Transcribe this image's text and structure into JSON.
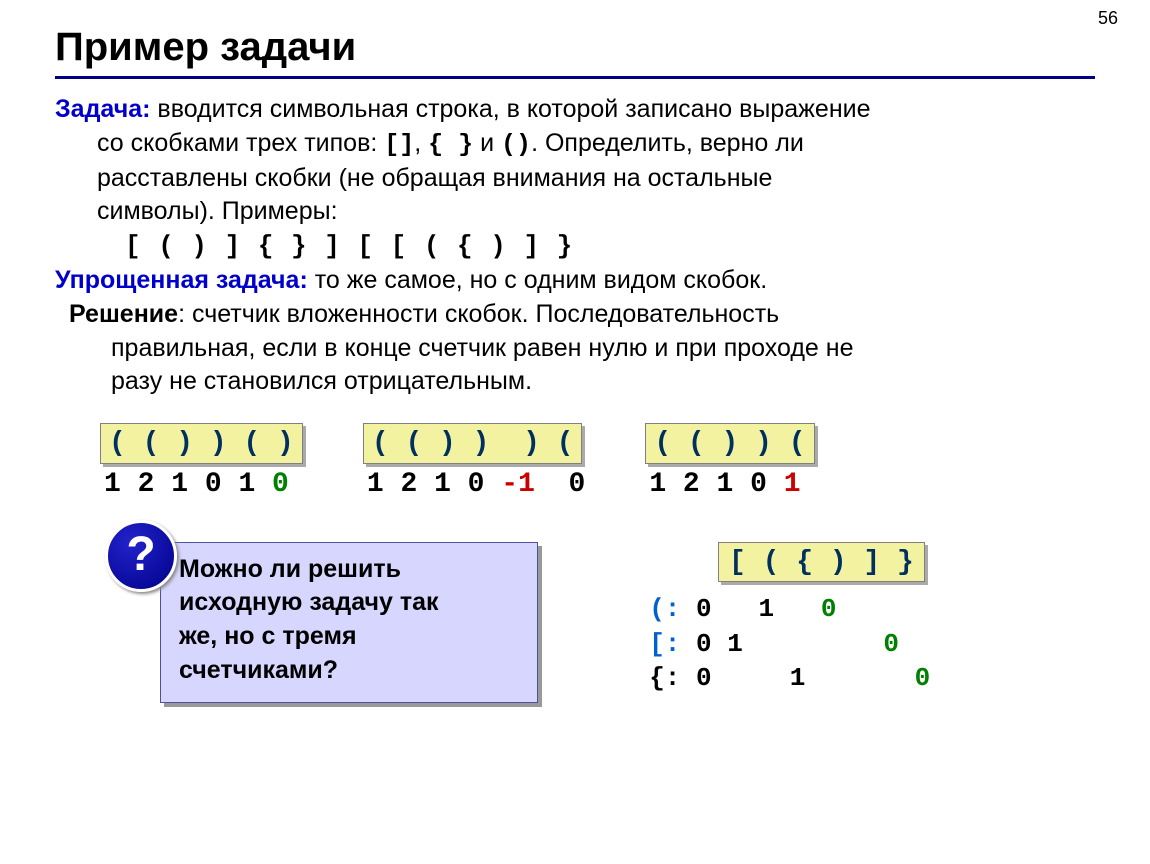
{
  "page_number": "56",
  "title": "Пример задачи",
  "task": {
    "label": "Задача:",
    "text1": " вводится символьная строка, в которой записано выражение",
    "text2": "со скобками трех типов: ",
    "brackets": {
      "b1": "[]",
      "sep1": ", ",
      "b2": "{ }",
      "sep2": " и ",
      "b3": "()"
    },
    "text3": ". Определить, верно ли",
    "text4": "расставлены скобки (не обращая внимания на остальные",
    "text5": "символы). Примеры:"
  },
  "examples_line": "[ ( ) ] { }     ] [     [ ( { ) ] }",
  "simplified": {
    "label": "Упрощенная задача:",
    "text": " то же самое, но с одним видом скобок."
  },
  "solution": {
    "label": "Решение",
    "text1": ": счетчик вложенности скобок. Последовательность",
    "text2": "правильная, если в конце счетчик равен нулю и при проходе не",
    "text3": "разу не становился отрицательным."
  },
  "counters": [
    {
      "brackets": "( ( ) ) ( )",
      "nums": [
        {
          "v": "1 ",
          "c": ""
        },
        {
          "v": "2 ",
          "c": ""
        },
        {
          "v": "1 ",
          "c": ""
        },
        {
          "v": "0 ",
          "c": ""
        },
        {
          "v": "1 ",
          "c": ""
        },
        {
          "v": "0",
          "c": "g"
        }
      ]
    },
    {
      "brackets": "( ( ) )  ) (",
      "nums": [
        {
          "v": "1 ",
          "c": ""
        },
        {
          "v": "2 ",
          "c": ""
        },
        {
          "v": "1 ",
          "c": ""
        },
        {
          "v": "0 ",
          "c": ""
        },
        {
          "v": "-1 ",
          "c": "r"
        },
        {
          "v": " 0",
          "c": ""
        }
      ]
    },
    {
      "brackets": "( ( ) ) (",
      "nums": [
        {
          "v": "1 ",
          "c": ""
        },
        {
          "v": "2 ",
          "c": ""
        },
        {
          "v": "1 ",
          "c": ""
        },
        {
          "v": "0 ",
          "c": ""
        },
        {
          "v": "1",
          "c": "r"
        }
      ]
    }
  ],
  "question": {
    "mark": "?",
    "line1": "Можно ли решить",
    "line2": "исходную задачу так",
    "line3": "же, но с тремя",
    "line4": "счетчиками?"
  },
  "triple": {
    "brackets": "[ ( { ) ] }",
    "rows": [
      {
        "label": "(:",
        "cls": "lp",
        "cells": " 0   1   0        "
      },
      {
        "label": "[:",
        "cls": "ls",
        "cells": " 0 1         0    "
      },
      {
        "label": "{:",
        "cls": "lc",
        "cells": " 0     1       0  "
      }
    ],
    "final_zero_positions": {
      "row0": [
        11
      ],
      "row1": [
        13
      ],
      "row2": [
        15
      ]
    }
  }
}
